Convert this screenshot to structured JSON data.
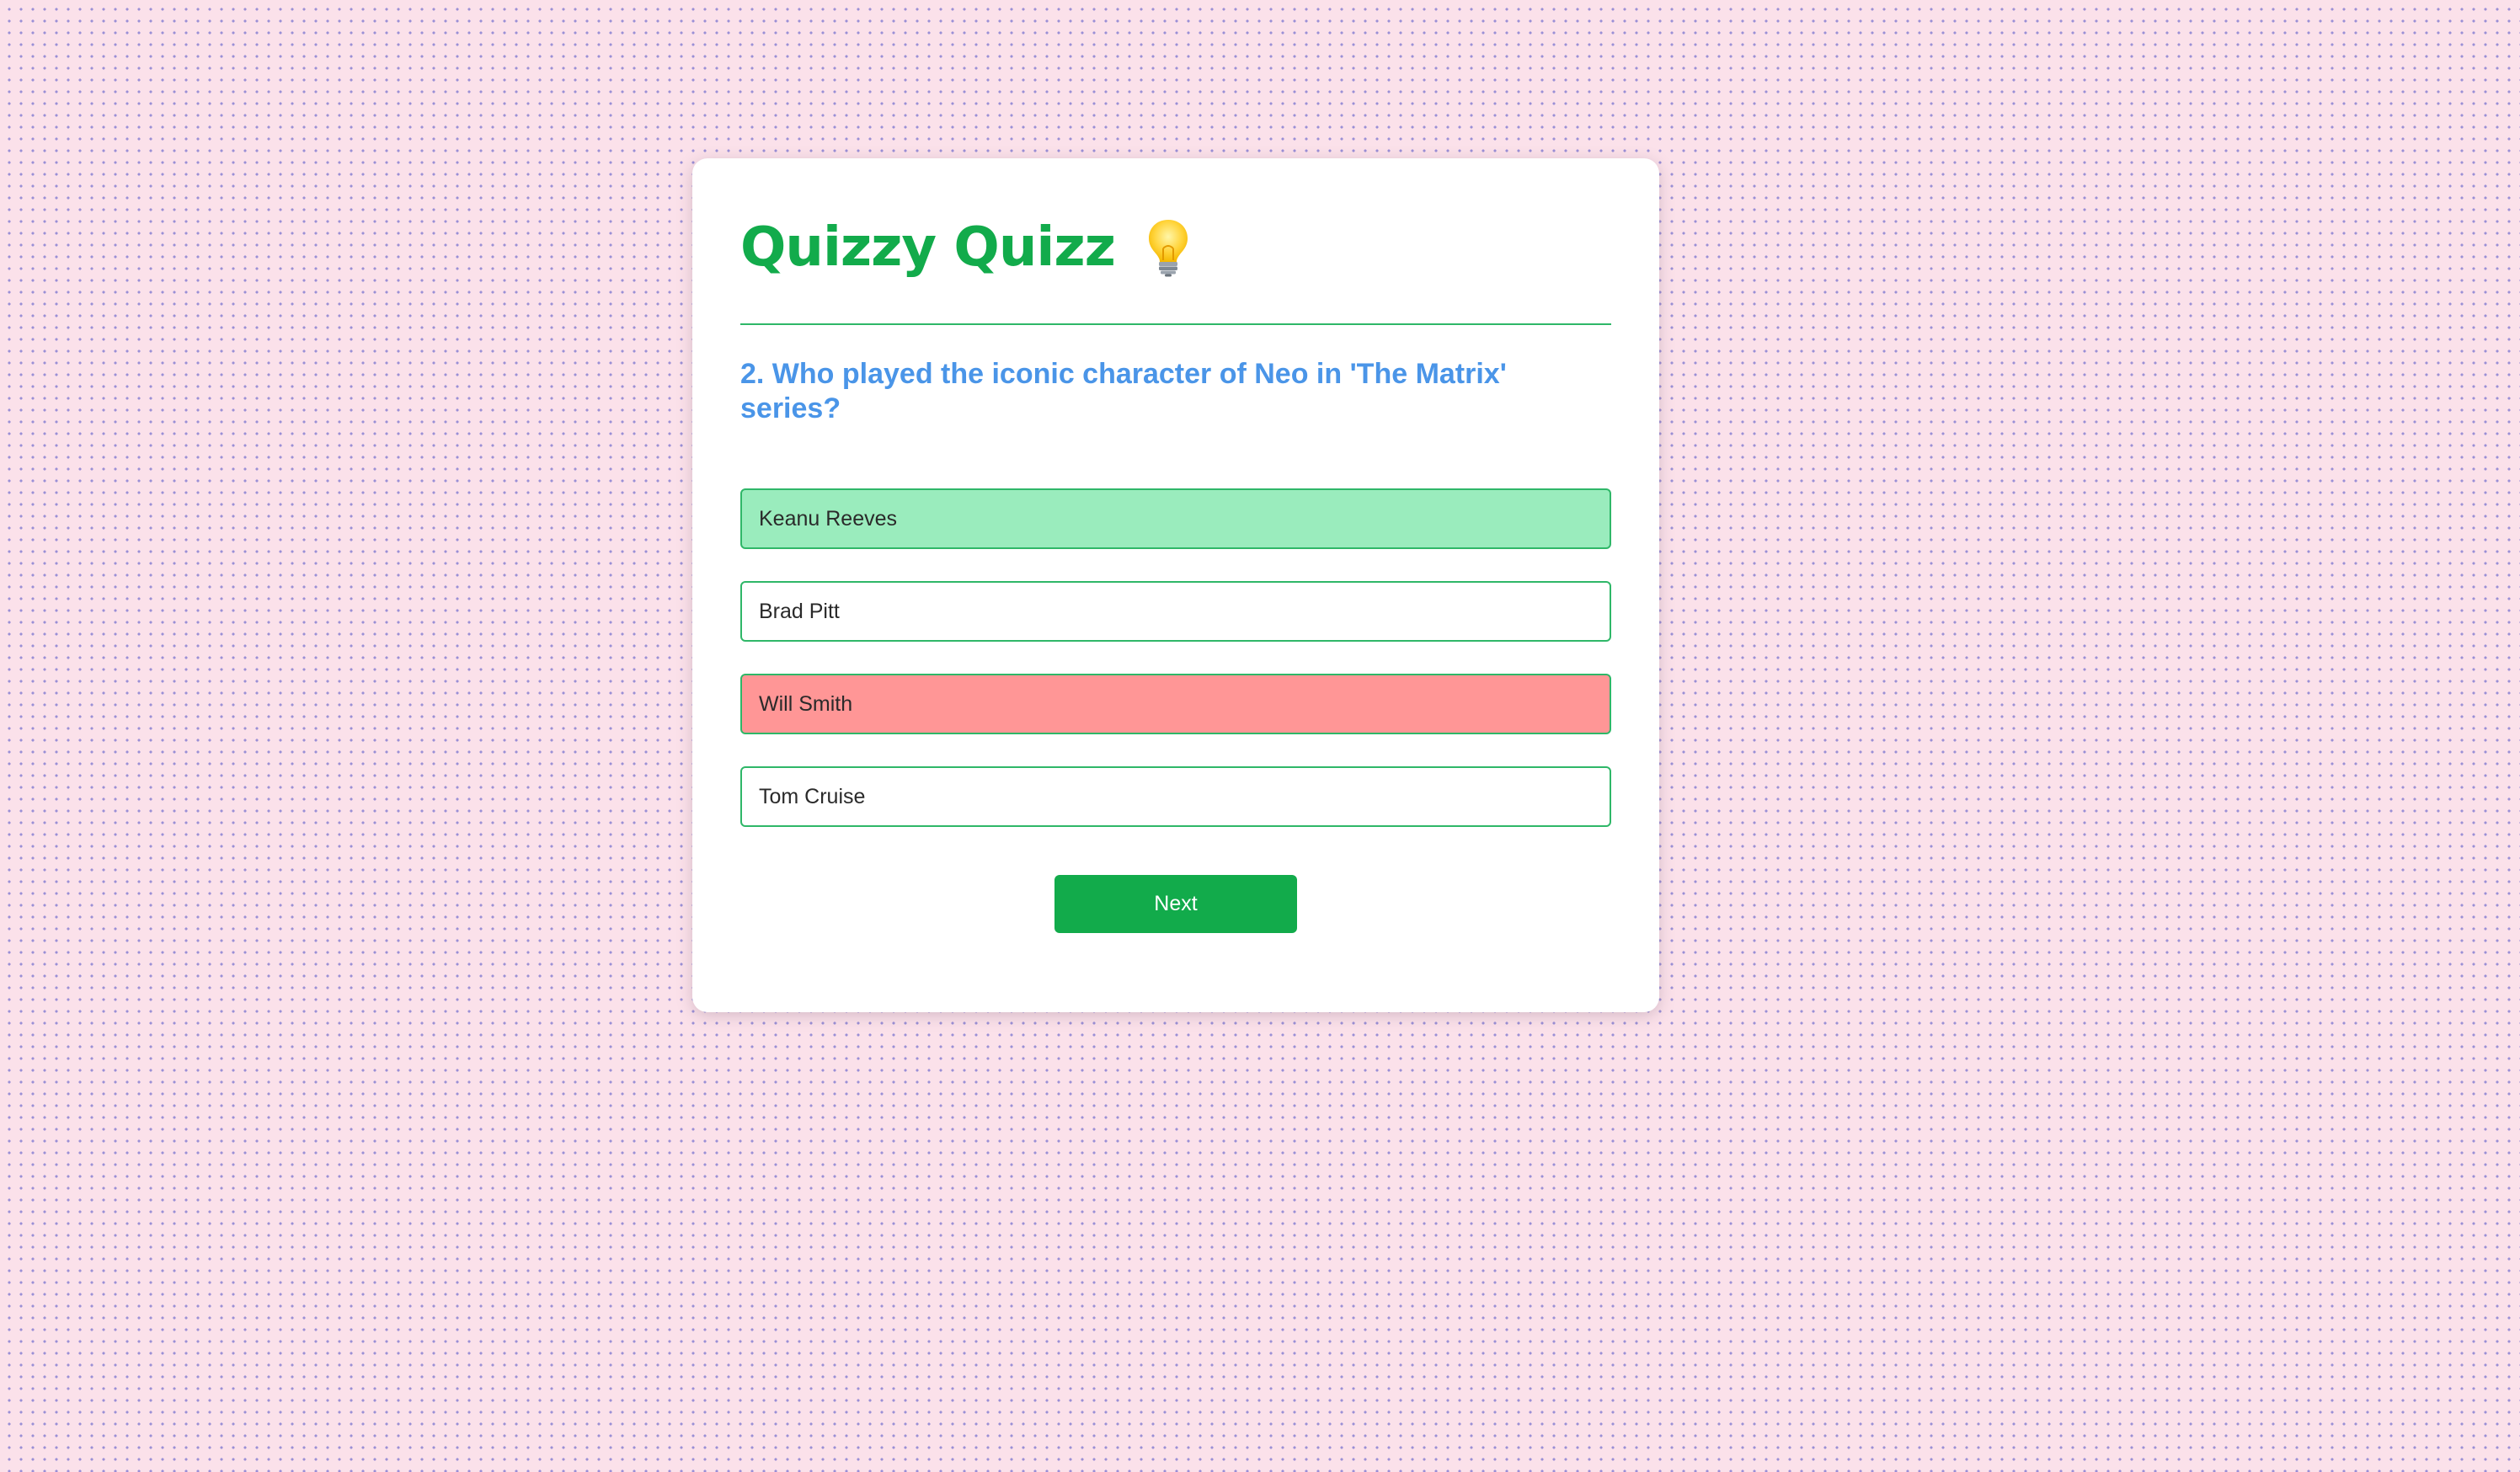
{
  "app": {
    "title": "Quizzy Quizz",
    "title_icon": "lightbulb-icon"
  },
  "question": {
    "text": "2. Who played the iconic character of Neo in 'The Matrix' series?"
  },
  "options": [
    {
      "label": "Keanu Reeves",
      "state": "correct"
    },
    {
      "label": "Brad Pitt",
      "state": "neutral"
    },
    {
      "label": "Will Smith",
      "state": "wrong"
    },
    {
      "label": "Tom Cruise",
      "state": "neutral"
    }
  ],
  "next_button": {
    "label": "Next"
  },
  "colors": {
    "brand_green": "#12ab4b",
    "question_blue": "#4a95e8",
    "correct_bg": "#9aecbd",
    "wrong_bg": "#ff9696",
    "page_bg": "#fbe1ea"
  }
}
